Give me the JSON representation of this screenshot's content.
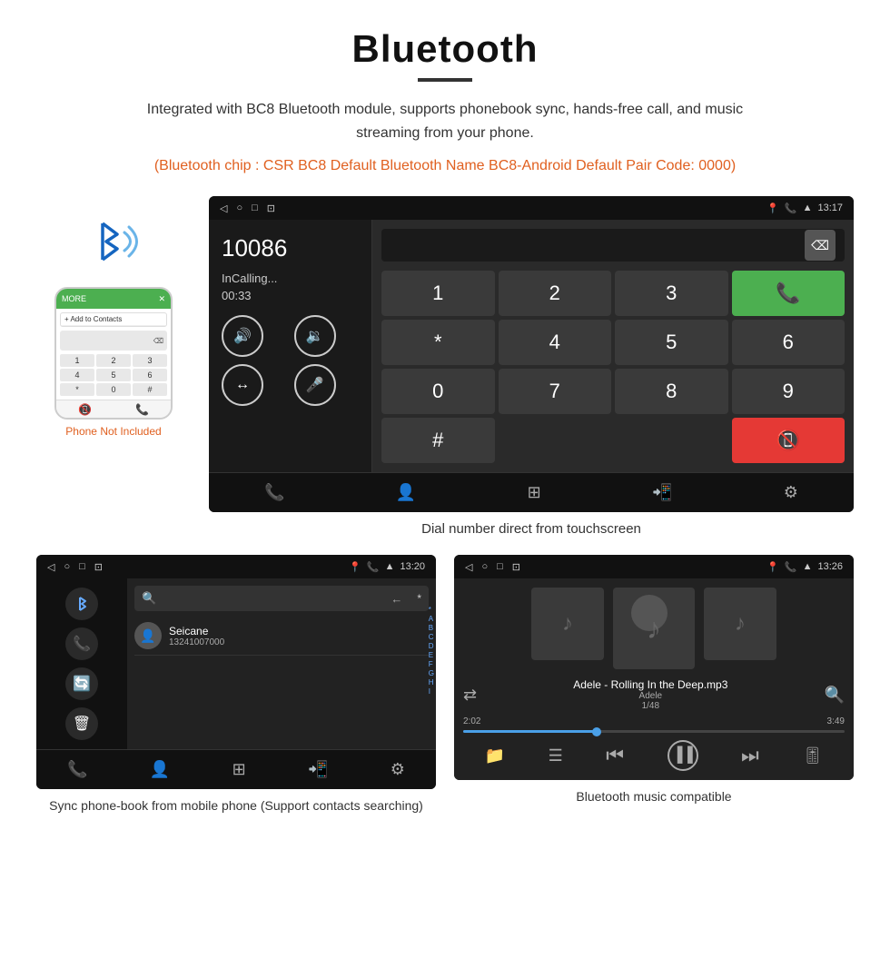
{
  "page": {
    "title": "Bluetooth",
    "title_underline": true,
    "description": "Integrated with BC8 Bluetooth module, supports phonebook sync, hands-free call, and music streaming from your phone.",
    "highlight": "(Bluetooth chip : CSR BC8    Default Bluetooth Name BC8-Android    Default Pair Code: 0000)",
    "dial_caption": "Dial number direct from touchscreen",
    "phonebook_caption": "Sync phone-book from mobile phone\n(Support contacts searching)",
    "music_caption": "Bluetooth music compatible",
    "phone_not_included": "Phone Not Included"
  },
  "statusbar": {
    "time1": "13:17",
    "time2": "13:20",
    "time3": "13:26"
  },
  "dial_screen": {
    "number": "10086",
    "status": "InCalling...",
    "timer": "00:33",
    "keys": [
      "1",
      "2",
      "3",
      "*",
      "",
      "4",
      "5",
      "6",
      "0",
      "",
      "7",
      "8",
      "9",
      "#",
      ""
    ]
  },
  "phonebook": {
    "contact_name": "Seicane",
    "contact_number": "13241007000",
    "alpha_letters": [
      "*",
      "A",
      "B",
      "C",
      "D",
      "E",
      "F",
      "G",
      "H",
      "I"
    ]
  },
  "music": {
    "track_name": "Adele - Rolling In the Deep.mp3",
    "artist": "Adele",
    "track_index": "1/48",
    "time_current": "2:02",
    "time_total": "3:49"
  },
  "labels": {
    "delete": "✕",
    "call_green": "📞",
    "call_red": "📞",
    "vol_up": "🔊+",
    "vol_down": "🔊-",
    "transfer": "↔",
    "mic": "🎤"
  }
}
